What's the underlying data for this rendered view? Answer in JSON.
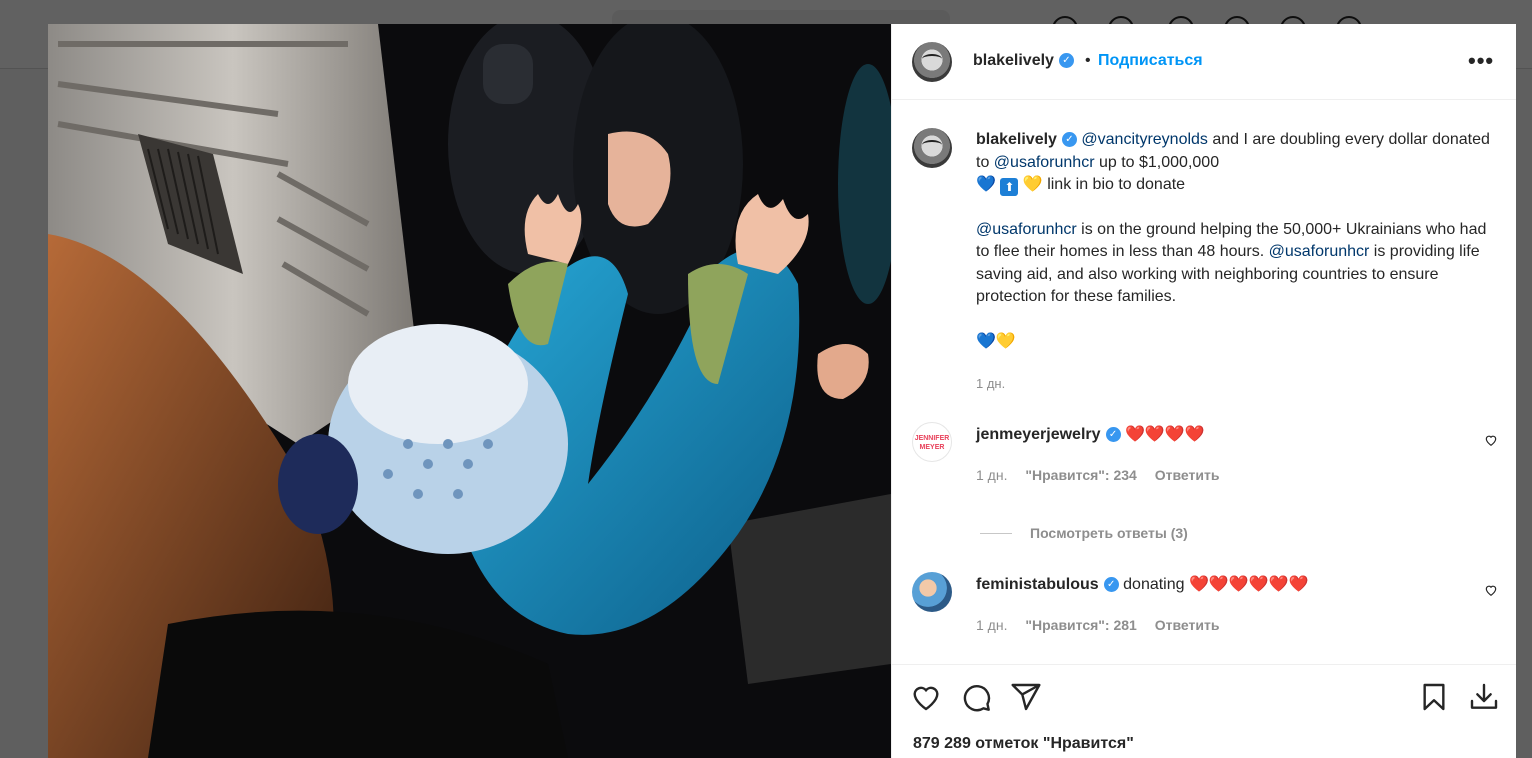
{
  "post": {
    "author": "blakelively",
    "follow_label": "Подписаться",
    "separator": "•",
    "more_label": "•••"
  },
  "caption": {
    "author": "blakelively",
    "mention1": "@vancityreynolds",
    "line1_rest": " and I are doubling every dollar",
    "line2_pre": "donated to ",
    "mention2": "@usaforunhcr",
    "line2_rest": " up to $1,000,000",
    "emoji_heart_blue": "💙",
    "emoji_up": "⬆",
    "emoji_heart_yellow": "💛",
    "line3_rest": " link in bio to donate",
    "para2_mention": "@usaforunhcr",
    "para2_text1": " is on the ground helping the 50,000+ Ukrainians who had to flee their homes in less than 48 hours. ",
    "para2_mention2": "@usaforunhcr",
    "para2_text2": " is providing life saving aid, and also working with neighboring countries to ensure protection for these families.",
    "closing_blue": "💙",
    "closing_yellow": "💛",
    "time": "1 дн."
  },
  "comments": [
    {
      "user": "jenmeyerjewelry",
      "avatar_text": "JENNIFER MEYER",
      "text": "❤️❤️❤️❤️",
      "time": "1 дн.",
      "likes": "\"Нравится\": 234",
      "reply": "Ответить",
      "view_replies": "Посмотреть ответы (3)"
    },
    {
      "user": "feministabulous",
      "text_prefix": "donating ",
      "text_hearts": "❤️❤️❤️❤️❤️❤️",
      "time": "1 дн.",
      "likes": "\"Нравится\": 281",
      "reply": "Ответить"
    }
  ],
  "footer": {
    "likes_count": "879 289 отметок \"Нравится\""
  },
  "icons": {
    "like": "heart-icon",
    "comment": "comment-icon",
    "share": "share-icon",
    "save": "bookmark-icon",
    "download": "download-icon"
  },
  "colors": {
    "link": "#0095f6",
    "mention": "#00376b",
    "verified": "#3897f0",
    "secondary_text": "#8e8e8e"
  }
}
